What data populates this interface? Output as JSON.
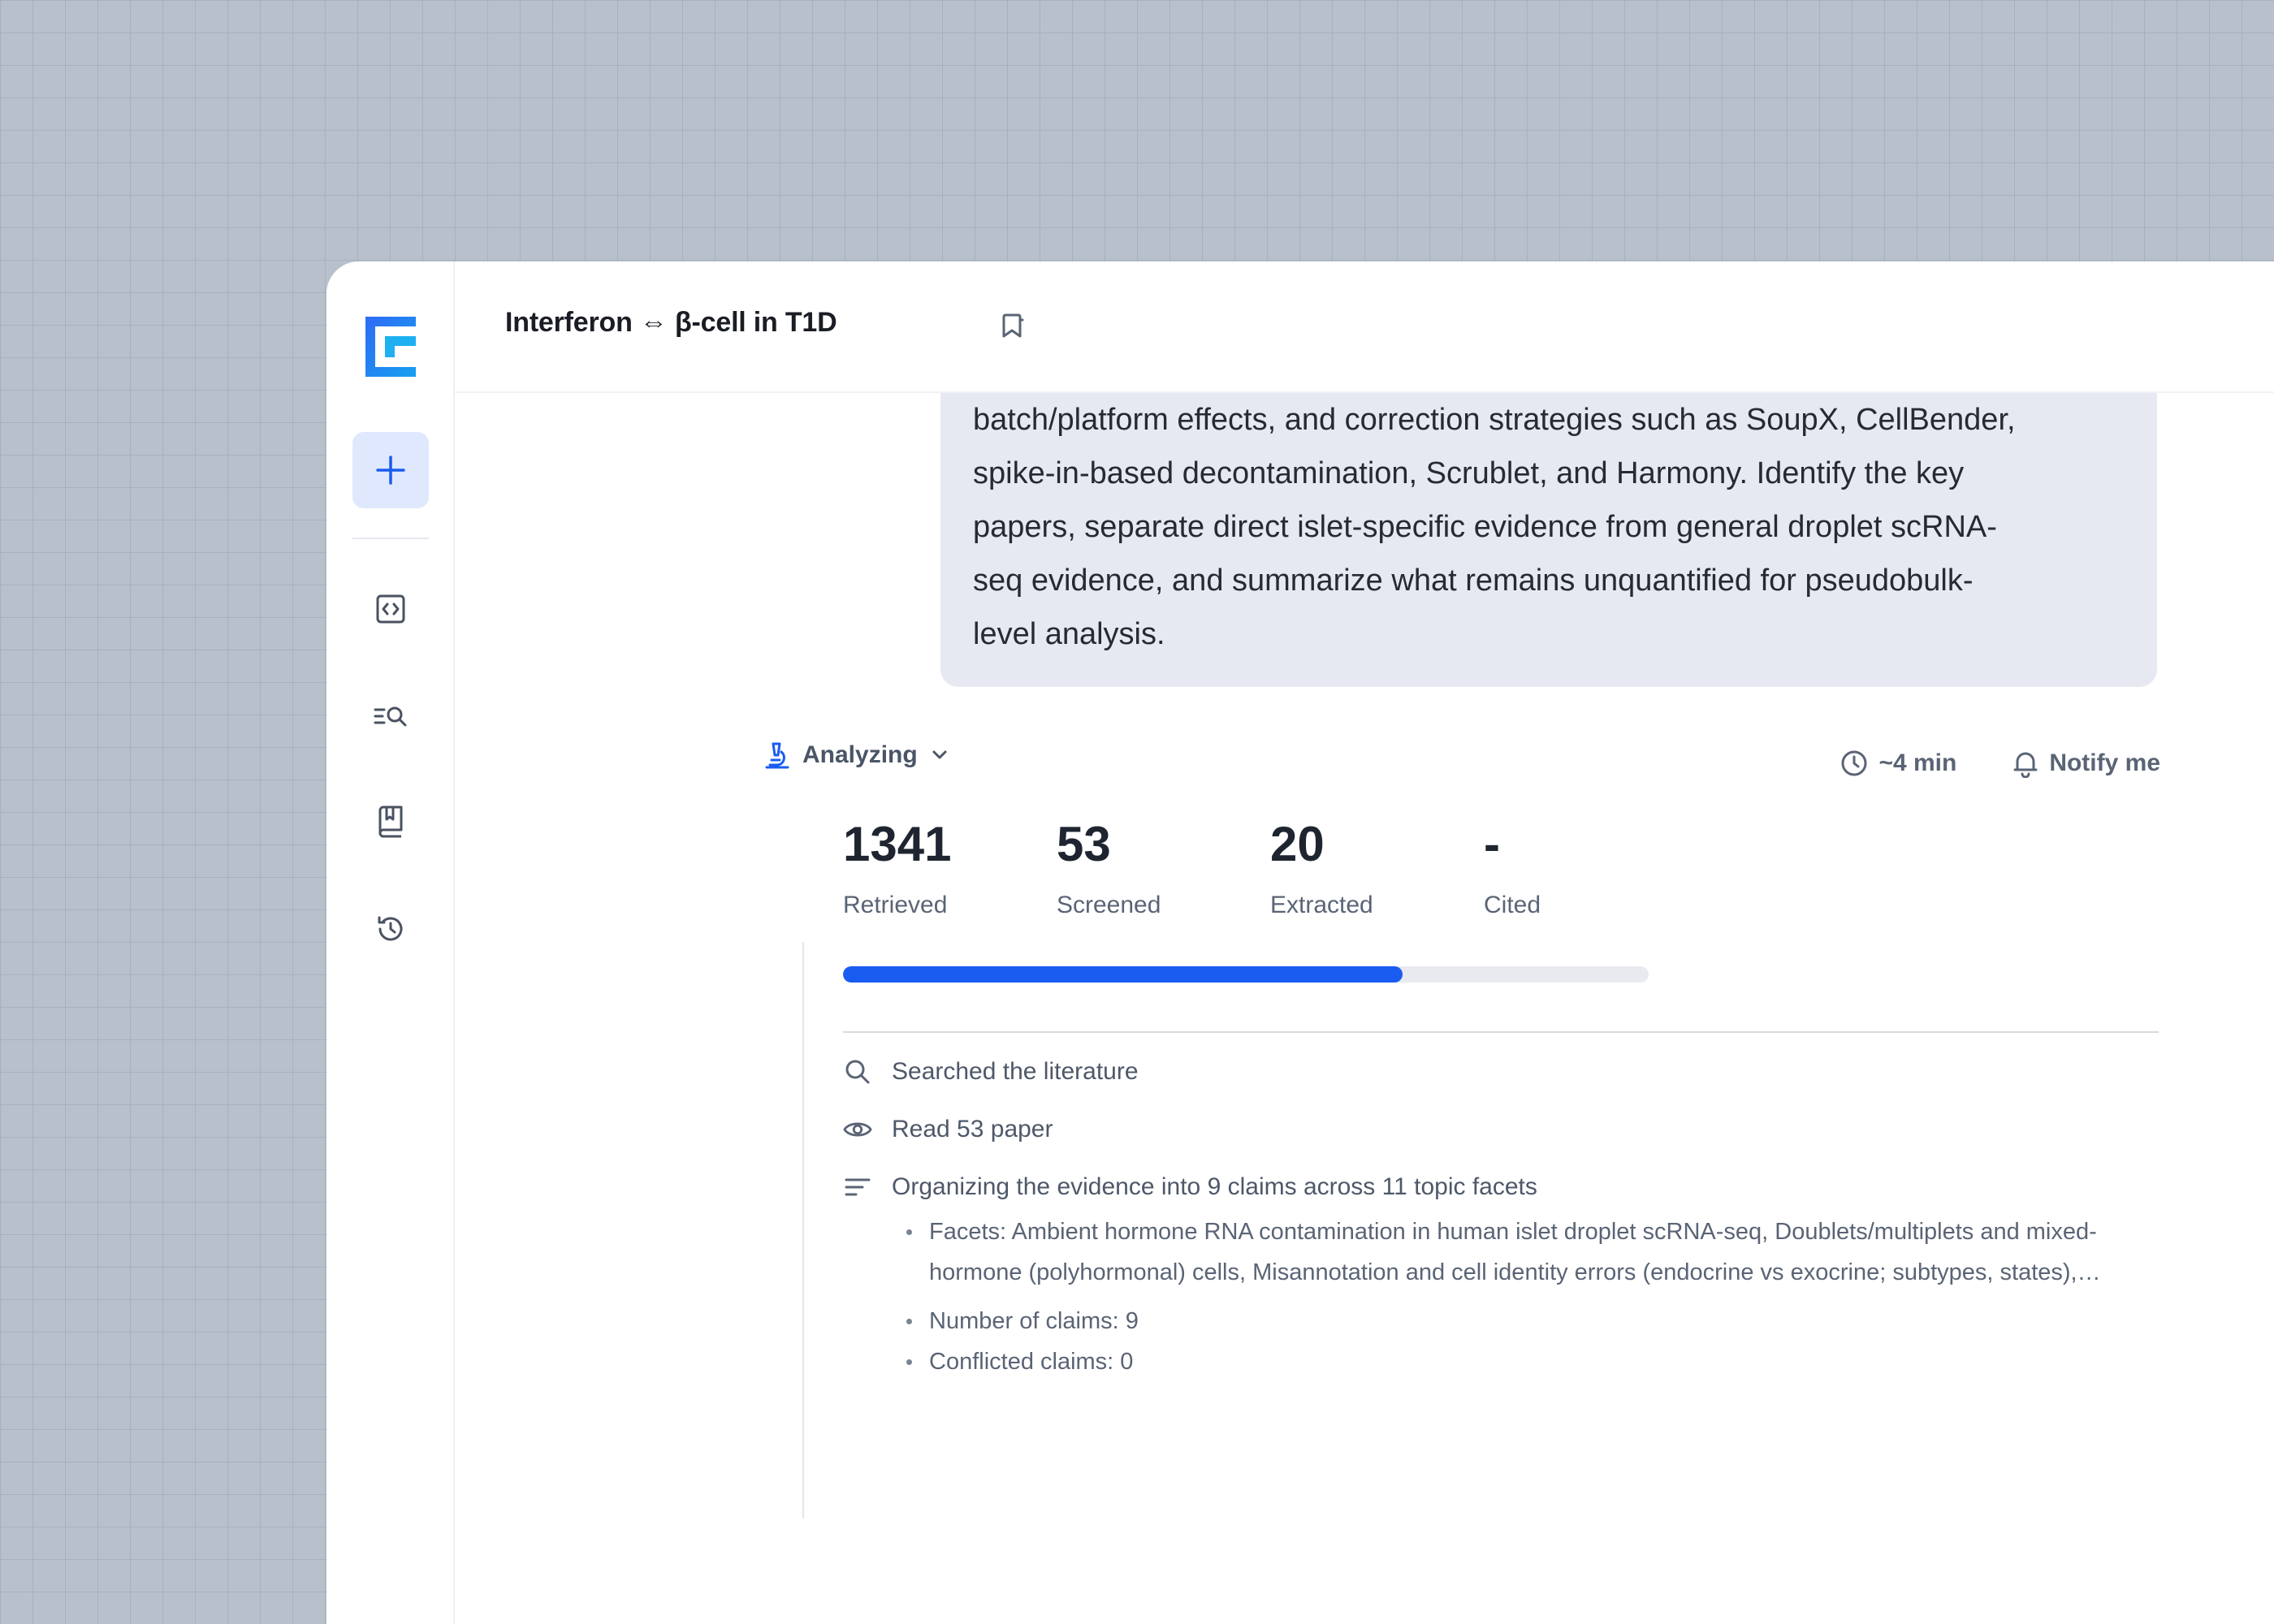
{
  "header": {
    "title": "Interferon ⇔ β-cell in T1D"
  },
  "prompt": {
    "lines": [
      "batch/platform effects, and correction strategies such as SoupX, CellBender,",
      "spike-in-based decontamination, Scrublet, and Harmony. Identify the key",
      "papers, separate direct islet-specific evidence from general droplet scRNA-",
      "seq evidence, and summarize what remains unquantified for pseudobulk-",
      "level analysis."
    ]
  },
  "status": {
    "label": "Analyzing",
    "eta": "~4 min",
    "notify": "Notify me"
  },
  "stats": [
    {
      "value": "1341",
      "label": "Retrieved"
    },
    {
      "value": "53",
      "label": "Screened"
    },
    {
      "value": "20",
      "label": "Extracted"
    },
    {
      "value": "-",
      "label": "Cited"
    }
  ],
  "progress": {
    "fraction": 0.695
  },
  "steps": [
    {
      "icon": "search-icon",
      "text": "Searched the literature"
    },
    {
      "icon": "eye-icon",
      "text": "Read 53 paper"
    },
    {
      "icon": "list-icon",
      "text": "Organizing the evidence into 9 claims across 11 topic facets"
    }
  ],
  "details": [
    "Facets: Ambient hormone RNA contamination in human islet droplet scRNA-seq, Doublets/multiplets and mixed-hormone (polyhormonal) cells, Misannotation and cell identity errors (endocrine vs exocrine; subtypes, states), Batch/platform effects",
    "Number of claims: 9",
    "Conflicted claims: 0"
  ],
  "colors": {
    "accent": "#1a5cf0",
    "background": "#b8c0cc",
    "bubble": "#e6e9f2"
  }
}
